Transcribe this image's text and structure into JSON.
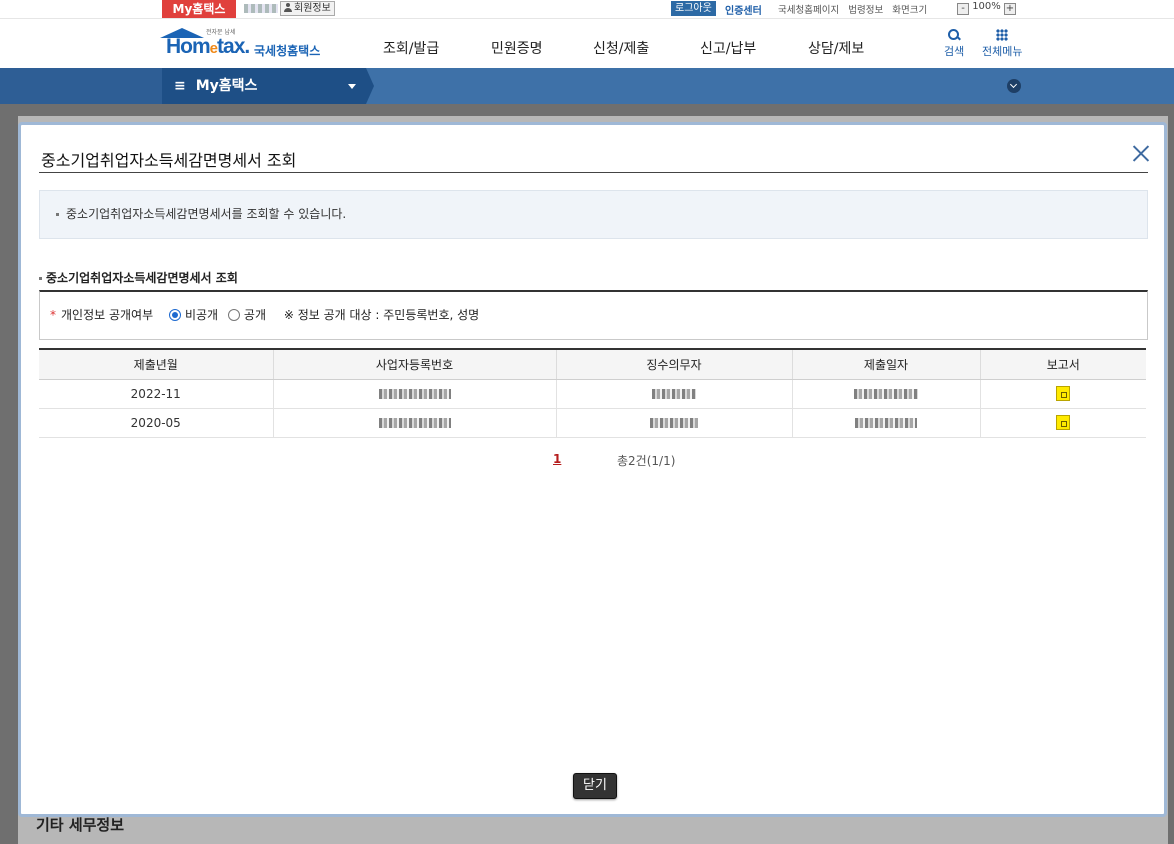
{
  "util_bar": {
    "my_hometax_tab": "My홈택스",
    "member_info": "회원정보",
    "logout": "로그아웃",
    "cert_center": "인증센터",
    "links": [
      "국세청홈페이지",
      "법령정보",
      "화면크기"
    ],
    "zoom_minus": "-",
    "zoom_level": "100%",
    "zoom_plus": "+"
  },
  "header": {
    "logo_tagline": "전자문 납세",
    "logo_text_main": "Hom",
    "logo_text_e": "e",
    "logo_text_tail": "tax.",
    "logo_text_kr": "국세청홈택스",
    "menu": [
      "조회/발급",
      "민원증명",
      "신청/제출",
      "신고/납부",
      "상담/제보"
    ],
    "search_label": "검색",
    "all_menu_label": "전체메뉴"
  },
  "navbar": {
    "my_hometax": "My홈택스",
    "hamburger": "≡"
  },
  "background": {
    "section_text": "기타 세무정보"
  },
  "modal": {
    "title": "중소기업취업자소득세감면명세서 조회",
    "info_text": "중소기업취업자소득세감면명세서를 조회할 수 있습니다.",
    "section_title": "중소기업취업자소득세감면명세서 조회",
    "filter": {
      "required_mark": "*",
      "label": "개인정보 공개여부",
      "options": [
        "비공개",
        "공개"
      ],
      "selected": "비공개",
      "note": "※ 정보 공개 대상 : 주민등록번호, 성명"
    },
    "table": {
      "headers": [
        "제출년월",
        "사업자등록번호",
        "징수의무자",
        "제출일자",
        "보고서"
      ],
      "rows": [
        {
          "period": "2022-11"
        },
        {
          "period": "2020-05"
        }
      ]
    },
    "pager": {
      "current_page": "1",
      "total": "총2건(1/1)"
    },
    "close_button": "닫기"
  },
  "colors": {
    "accent_red": "#e0403c",
    "nav_blue": "#3e71a8",
    "brand_blue": "#1b64b5",
    "report_icon": "#ffea00"
  },
  "icons": {
    "search": "magnifier-icon",
    "all_menu": "grid-icon",
    "close": "close-x-icon",
    "report": "document-icon"
  }
}
